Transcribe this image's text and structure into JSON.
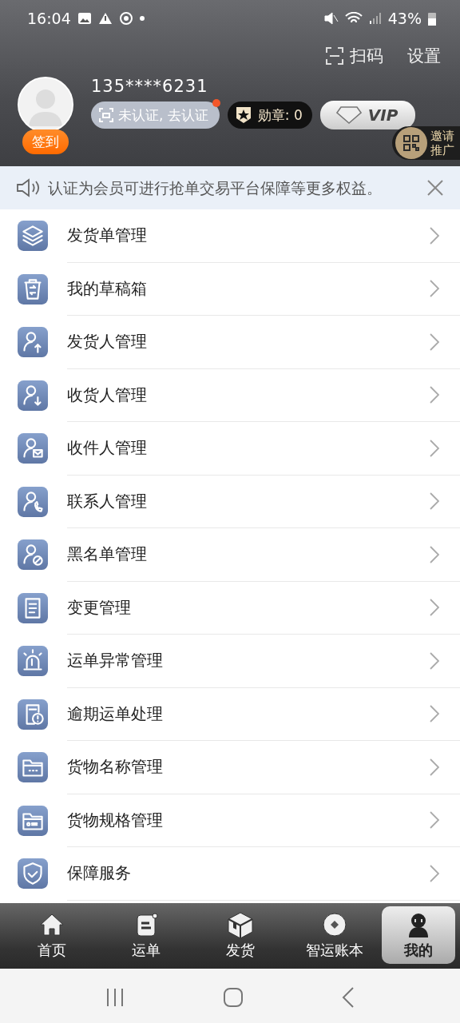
{
  "status_bar": {
    "time": "16:04",
    "battery": "43%"
  },
  "header": {
    "scan": "扫码",
    "settings": "设置",
    "phone": "135****6231",
    "check_in": "签到",
    "certify": {
      "label": "未认证, 去认证",
      "dot": true
    },
    "medal": "勋章: 0",
    "vip": "VIP",
    "invite": "邀请推广"
  },
  "notice": {
    "text": "认证为会员可进行抢单交易平台保障等更多权益。"
  },
  "menu": [
    {
      "label": "发货单管理",
      "kind": "layers"
    },
    {
      "label": "我的草稿箱",
      "kind": "bin"
    },
    {
      "label": "发货人管理",
      "kind": "person-up"
    },
    {
      "label": "收货人管理",
      "kind": "person-down"
    },
    {
      "label": "收件人管理",
      "kind": "person-mail"
    },
    {
      "label": "联系人管理",
      "kind": "person-phone"
    },
    {
      "label": "黑名单管理",
      "kind": "person-block"
    },
    {
      "label": "变更管理",
      "kind": "form"
    },
    {
      "label": "运单异常管理",
      "kind": "alarm"
    },
    {
      "label": "逾期运单处理",
      "kind": "doc-alert"
    },
    {
      "label": "货物名称管理",
      "kind": "folder-dots"
    },
    {
      "label": "货物规格管理",
      "kind": "folder-card"
    },
    {
      "label": "保障服务",
      "kind": "shield"
    }
  ],
  "tabs": [
    {
      "label": "首页",
      "kind": "home",
      "selected": false
    },
    {
      "label": "运单",
      "kind": "note",
      "selected": false
    },
    {
      "label": "发货",
      "kind": "box",
      "selected": false
    },
    {
      "label": "智运账本",
      "kind": "coin",
      "selected": false
    },
    {
      "label": "我的",
      "kind": "me",
      "selected": true
    }
  ]
}
